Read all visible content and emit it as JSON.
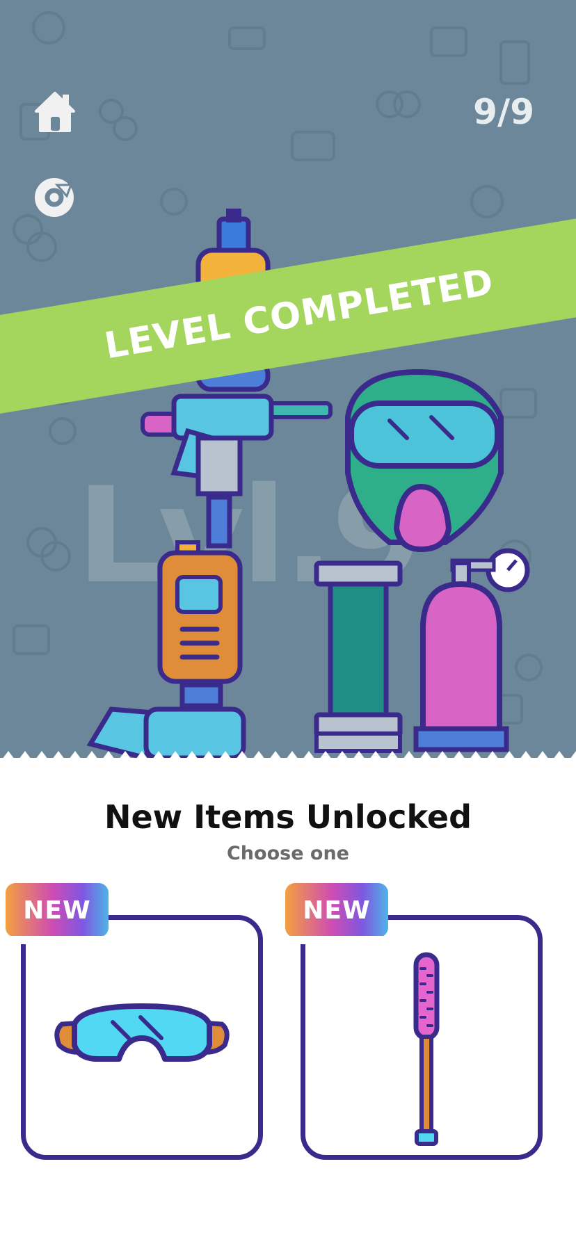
{
  "hud": {
    "progress": "9/9",
    "home_icon": "home-icon",
    "restart_icon": "restart-icon"
  },
  "banner": {
    "text": "LEVEL COMPLETED"
  },
  "background": {
    "watermark": "Lvl.9"
  },
  "unlock": {
    "title": "New Items Unlocked",
    "subtitle": "Choose one",
    "items": [
      {
        "badge": "NEW",
        "icon": "goggles-icon"
      },
      {
        "badge": "NEW",
        "icon": "barrel-swab-icon"
      }
    ]
  },
  "colors": {
    "background": "#6b8799",
    "banner": "#a4d65e",
    "outline": "#3a2a8c",
    "panel": "#ffffff"
  }
}
